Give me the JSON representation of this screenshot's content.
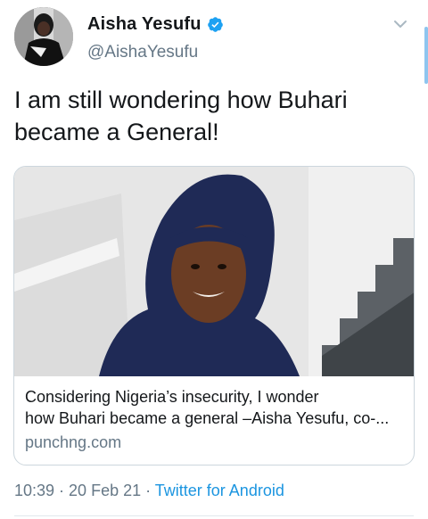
{
  "tweet": {
    "author": {
      "display_name": "Aisha Yesufu",
      "handle": "@AishaYesufu",
      "verified": true
    },
    "text_line1": "I am still wondering how Buhari",
    "text_line2": "became a General!",
    "card": {
      "title_line1": "Considering Nigeria’s insecurity, I wonder",
      "title_line2": "how Buhari became a general –Aisha Yesufu, co-...",
      "domain": "punchng.com"
    },
    "meta": {
      "time": "10:39",
      "separator": " · ",
      "date": "20 Feb 21",
      "source": "Twitter for Android"
    }
  },
  "colors": {
    "text": "#14171a",
    "secondary": "#657786",
    "accent": "#1b95e0",
    "border": "#ccd6dd",
    "scroll_indicator": "#8ec5ef"
  },
  "icons": {
    "verified": "verified-badge-icon",
    "chevron": "chevron-down-icon"
  }
}
